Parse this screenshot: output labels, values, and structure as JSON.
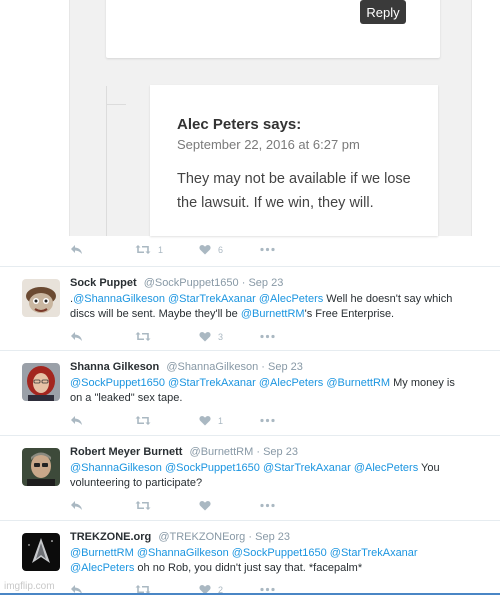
{
  "embed": {
    "reply_label": "Reply",
    "comment": {
      "author": "Alec Peters says:",
      "date": "September 22, 2016 at 6:27 pm",
      "body": "They may not be available if we lose the lawsuit. If we win, they will."
    },
    "actions": {
      "retweets": "1",
      "likes": "6"
    }
  },
  "tweets": [
    {
      "name": "Sock Puppet",
      "handle": "@SockPuppet1650",
      "time": "Sep 23",
      "text": [
        {
          "t": ".",
          "m": false
        },
        {
          "t": "@ShannaGilkeson",
          "m": true
        },
        {
          "t": " ",
          "m": false
        },
        {
          "t": "@StarTrekAxanar",
          "m": true
        },
        {
          "t": " ",
          "m": false
        },
        {
          "t": "@AlecPeters",
          "m": true
        },
        {
          "t": " Well he doesn't say which discs will be sent. Maybe they'll be ",
          "m": false
        },
        {
          "t": "@BurnettRM",
          "m": true
        },
        {
          "t": "'s Free Enterprise.",
          "m": false
        }
      ],
      "likes": "3",
      "avatar": "sock-puppet-avatar"
    },
    {
      "name": "Shanna Gilkeson",
      "handle": "@ShannaGilkeson",
      "time": "Sep 23",
      "text": [
        {
          "t": "@SockPuppet1650",
          "m": true
        },
        {
          "t": " ",
          "m": false
        },
        {
          "t": "@StarTrekAxanar",
          "m": true
        },
        {
          "t": " ",
          "m": false
        },
        {
          "t": "@AlecPeters",
          "m": true
        },
        {
          "t": " ",
          "m": false
        },
        {
          "t": "@BurnettRM",
          "m": true
        },
        {
          "t": " My money is on a \"leaked\" sex tape.",
          "m": false
        }
      ],
      "likes": "1",
      "avatar": "shanna-avatar"
    },
    {
      "name": "Robert Meyer Burnett",
      "handle": "@BurnettRM",
      "time": "Sep 23",
      "text": [
        {
          "t": "@ShannaGilkeson",
          "m": true
        },
        {
          "t": " ",
          "m": false
        },
        {
          "t": "@SockPuppet1650",
          "m": true
        },
        {
          "t": " ",
          "m": false
        },
        {
          "t": "@StarTrekAxanar",
          "m": true
        },
        {
          "t": " ",
          "m": false
        },
        {
          "t": "@AlecPeters",
          "m": true
        },
        {
          "t": " You volunteering to participate?",
          "m": false
        }
      ],
      "likes": "",
      "avatar": "burnett-avatar"
    },
    {
      "name": "TREKZONE.org",
      "handle": "@TREKZONEorg",
      "time": "Sep 23",
      "text": [
        {
          "t": "@BurnettRM",
          "m": true
        },
        {
          "t": " ",
          "m": false
        },
        {
          "t": "@ShannaGilkeson",
          "m": true
        },
        {
          "t": " ",
          "m": false
        },
        {
          "t": "@SockPuppet1650",
          "m": true
        },
        {
          "t": " ",
          "m": false
        },
        {
          "t": "@StarTrekAxanar",
          "m": true
        },
        {
          "t": " ",
          "m": false
        },
        {
          "t": "@AlecPeters",
          "m": true
        },
        {
          "t": " oh no Rob, you didn't just say that. *facepalm*",
          "m": false
        }
      ],
      "likes": "2",
      "avatar": "trekzone-avatar"
    }
  ],
  "watermark": "imgflip.com",
  "colors": {
    "mention": "#1b95e0",
    "icon": "#aab8c2",
    "meta": "#8899a6"
  }
}
